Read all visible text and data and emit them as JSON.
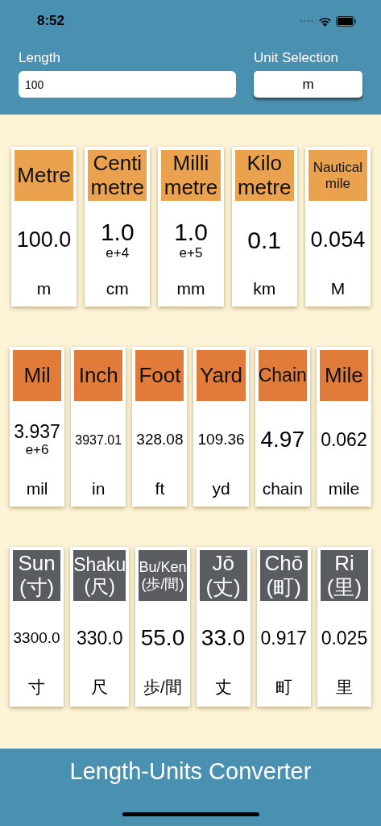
{
  "status_bar": {
    "time": "8:52"
  },
  "inputs": {
    "length_label": "Length",
    "length_value": "100",
    "unit_label": "Unit Selection",
    "unit_value": "m"
  },
  "groups": [
    {
      "color": "#eba24f",
      "cards": [
        {
          "name": [
            "Metre"
          ],
          "value": "100.0",
          "unit": "m"
        },
        {
          "name": [
            "Centi",
            "metre"
          ],
          "value": "1.0",
          "exponent": "e+4",
          "unit": "cm"
        },
        {
          "name": [
            "Milli",
            "metre"
          ],
          "value": "1.0",
          "exponent": "e+5",
          "unit": "mm"
        },
        {
          "name": [
            "Kilo",
            "metre"
          ],
          "value": "0.1",
          "unit": "km"
        },
        {
          "name": [
            "Nautical",
            "mile"
          ],
          "value": "0.054",
          "unit": "M"
        }
      ]
    },
    {
      "color": "#e07b3a",
      "cards": [
        {
          "name": [
            "Mil"
          ],
          "value": "3.937",
          "exponent": "e+6",
          "unit": "mil"
        },
        {
          "name": [
            "Inch"
          ],
          "value": "3937.01",
          "unit": "in"
        },
        {
          "name": [
            "Foot"
          ],
          "value": "328.08",
          "unit": "ft"
        },
        {
          "name": [
            "Yard"
          ],
          "value": "109.36",
          "unit": "yd"
        },
        {
          "name": [
            "Chain"
          ],
          "value": "4.97",
          "unit": "chain"
        },
        {
          "name": [
            "Mile"
          ],
          "value": "0.062",
          "unit": "mile"
        }
      ]
    },
    {
      "color": "#595d61",
      "cards": [
        {
          "name": [
            "Sun",
            "(寸)"
          ],
          "value": "3300.0",
          "unit": "寸"
        },
        {
          "name": [
            "Shaku",
            "(尺)"
          ],
          "value": "330.0",
          "unit": "尺"
        },
        {
          "name": [
            "Bu/Ken",
            "(歩/間)"
          ],
          "value": "55.0",
          "unit": "歩/間"
        },
        {
          "name": [
            "Jō",
            "(丈)"
          ],
          "value": "33.0",
          "unit": "丈"
        },
        {
          "name": [
            "Chō",
            "(町)"
          ],
          "value": "0.917",
          "unit": "町"
        },
        {
          "name": [
            "Ri",
            "(里)"
          ],
          "value": "0.025",
          "unit": "里"
        }
      ]
    }
  ],
  "footer": {
    "title": "Length-Units Converter"
  }
}
